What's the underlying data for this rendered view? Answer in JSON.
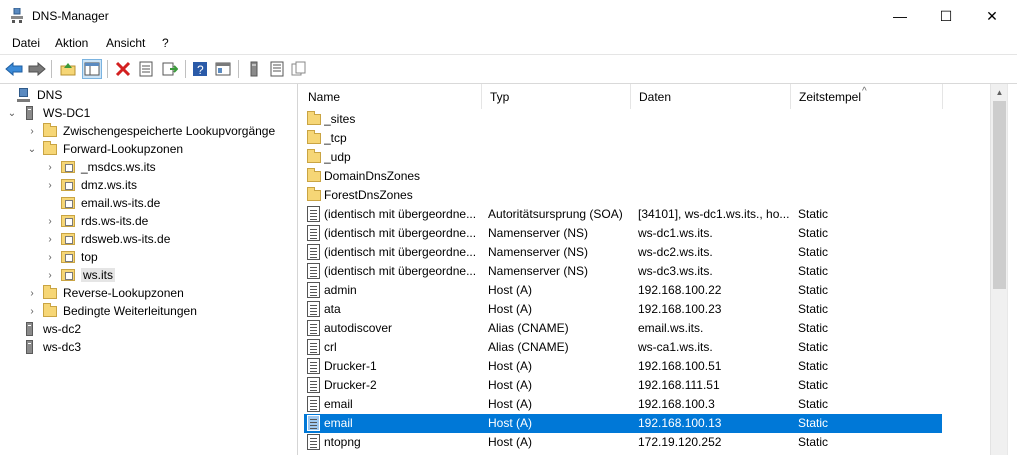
{
  "window": {
    "title": "DNS-Manager",
    "minimize_glyph": "—",
    "maximize_glyph": "☐",
    "close_glyph": "✕"
  },
  "menu": {
    "items": [
      "Datei",
      "Aktion",
      "Ansicht",
      "?"
    ]
  },
  "toolbar": {
    "icons": [
      "back-icon",
      "forward-icon",
      "up-folder-icon",
      "show-hide-tree-icon",
      "delete-icon",
      "properties-icon",
      "export-list-icon",
      "help-icon",
      "console-icon",
      "server-icon",
      "list-icon",
      "copy-icon"
    ]
  },
  "tree": {
    "root": "DNS",
    "server": "WS-DC1",
    "cached_lookups": "Zwischengespeicherte Lookupvorgänge",
    "forward_zones": "Forward-Lookupzonen",
    "zones": [
      "_msdcs.ws.its",
      "dmz.ws.its",
      "email.ws-its.de",
      "rds.ws-its.de",
      "rdsweb.ws-its.de",
      "top",
      "ws.its"
    ],
    "reverse_zones": "Reverse-Lookupzonen",
    "conditional_forwarders": "Bedingte Weiterleitungen",
    "other_servers": [
      "ws-dc2",
      "ws-dc3"
    ]
  },
  "list": {
    "columns": {
      "name": "Name",
      "type": "Typ",
      "data": "Daten",
      "timestamp": "Zeitstempel"
    },
    "sort_glyph": "^",
    "folders": [
      "_sites",
      "_tcp",
      "_udp",
      "DomainDnsZones",
      "ForestDnsZones"
    ],
    "records": [
      {
        "name": "(identisch mit übergeordne...",
        "type": "Autoritätsursprung (SOA)",
        "data": "[34101], ws-dc1.ws.its., ho...",
        "ts": "Static"
      },
      {
        "name": "(identisch mit übergeordne...",
        "type": "Namenserver (NS)",
        "data": "ws-dc1.ws.its.",
        "ts": "Static"
      },
      {
        "name": "(identisch mit übergeordne...",
        "type": "Namenserver (NS)",
        "data": "ws-dc2.ws.its.",
        "ts": "Static"
      },
      {
        "name": "(identisch mit übergeordne...",
        "type": "Namenserver (NS)",
        "data": "ws-dc3.ws.its.",
        "ts": "Static"
      },
      {
        "name": "admin",
        "type": "Host (A)",
        "data": "192.168.100.22",
        "ts": "Static"
      },
      {
        "name": "ata",
        "type": "Host (A)",
        "data": "192.168.100.23",
        "ts": "Static"
      },
      {
        "name": "autodiscover",
        "type": "Alias (CNAME)",
        "data": "email.ws.its.",
        "ts": "Static"
      },
      {
        "name": "crl",
        "type": "Alias (CNAME)",
        "data": "ws-ca1.ws.its.",
        "ts": "Static"
      },
      {
        "name": "Drucker-1",
        "type": "Host (A)",
        "data": "192.168.100.51",
        "ts": "Static"
      },
      {
        "name": "Drucker-2",
        "type": "Host (A)",
        "data": "192.168.111.51",
        "ts": "Static"
      },
      {
        "name": "email",
        "type": "Host (A)",
        "data": "192.168.100.3",
        "ts": "Static"
      },
      {
        "name": "email",
        "type": "Host (A)",
        "data": "192.168.100.13",
        "ts": "Static"
      },
      {
        "name": "ntopng",
        "type": "Host (A)",
        "data": "172.19.120.252",
        "ts": "Static"
      }
    ]
  },
  "scrollbar": {
    "up_glyph": "▲"
  },
  "colors": {
    "selection": "#0078d7",
    "folder": "#f6d676"
  }
}
